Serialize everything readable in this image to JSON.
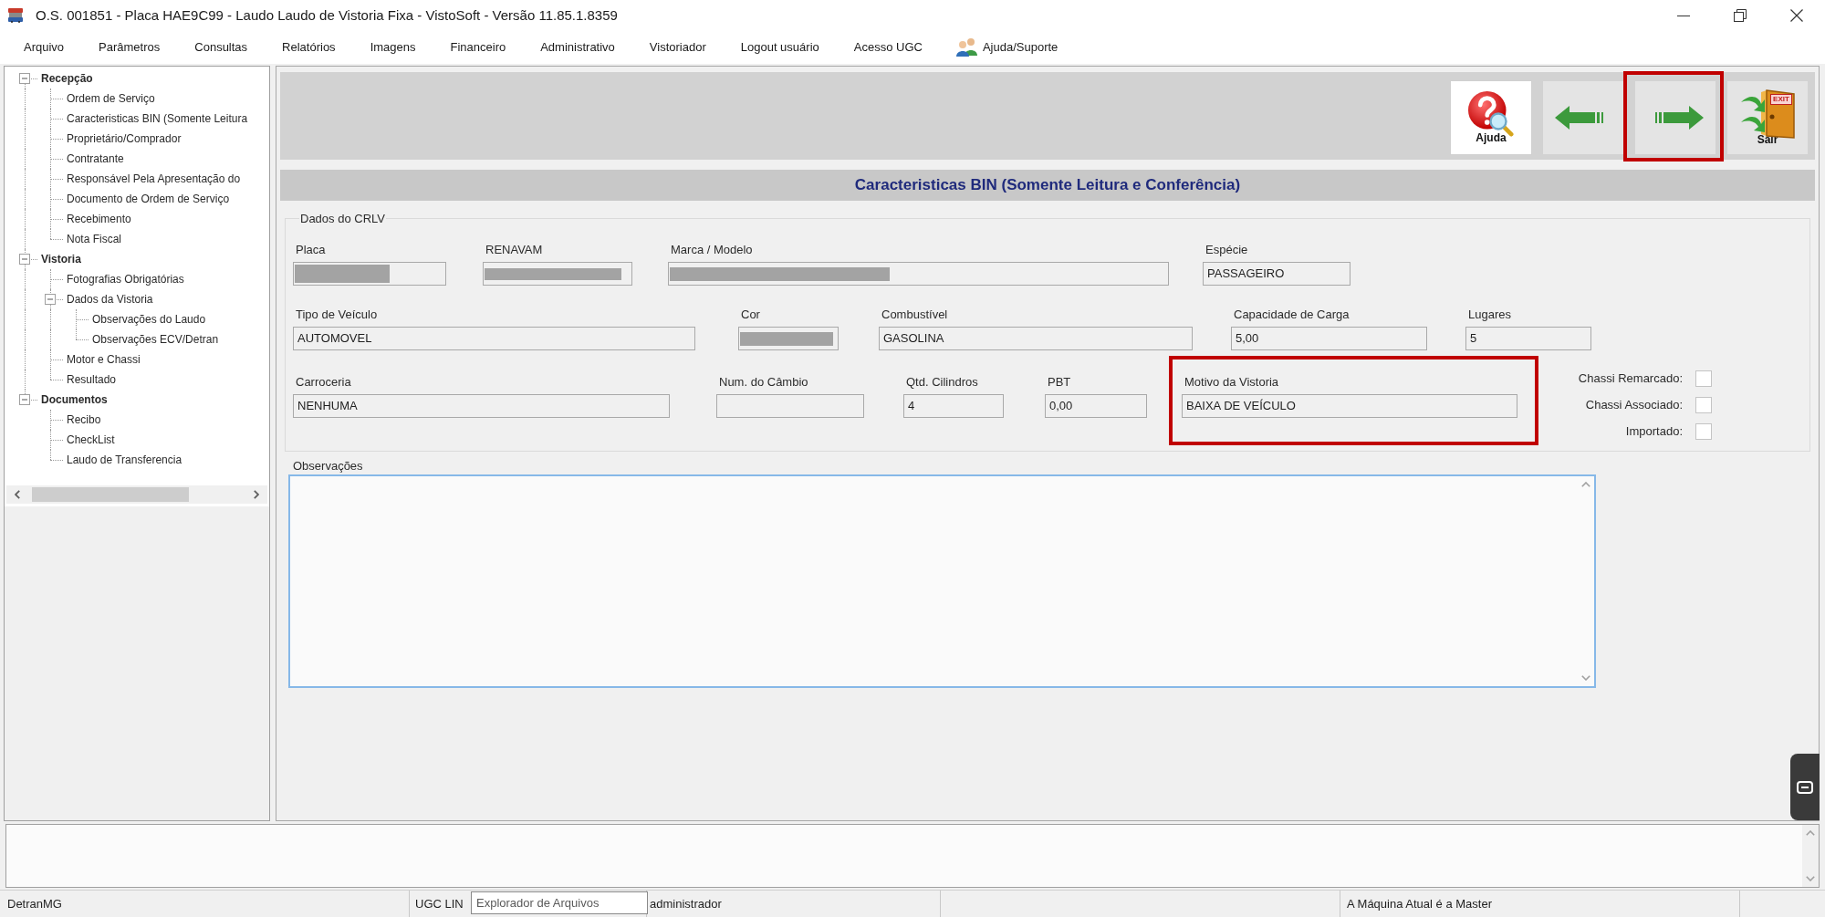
{
  "window": {
    "title": "O.S. 001851 - Placa HAE9C99 - Laudo Laudo de Vistoria Fixa - VistoSoft - Versão 11.85.1.8359"
  },
  "menu": [
    {
      "label": "Arquivo",
      "kind": "text"
    },
    {
      "label": "Parâmetros",
      "kind": "text"
    },
    {
      "label": "Consultas",
      "kind": "text"
    },
    {
      "label": "Relatórios",
      "kind": "text"
    },
    {
      "label": "Imagens",
      "kind": "text"
    },
    {
      "label": "Financeiro",
      "kind": "text"
    },
    {
      "label": "Administrativo",
      "kind": "text"
    },
    {
      "label": "Vistoriador",
      "kind": "text"
    },
    {
      "label": "Logout usuário",
      "kind": "text"
    },
    {
      "label": "Acesso UGC",
      "kind": "text"
    },
    {
      "label": "Ajuda/Suporte",
      "kind": "icon_text"
    }
  ],
  "tree": [
    {
      "label": "Recepção",
      "expanded": true,
      "children": [
        {
          "label": "Ordem de Serviço"
        },
        {
          "label": "Caracteristicas BIN (Somente Leitura"
        },
        {
          "label": "Proprietário/Comprador"
        },
        {
          "label": "Contratante"
        },
        {
          "label": "Responsável Pela Apresentação do"
        },
        {
          "label": "Documento de Ordem de Serviço"
        },
        {
          "label": "Recebimento"
        },
        {
          "label": "Nota Fiscal"
        }
      ]
    },
    {
      "label": "Vistoria",
      "expanded": true,
      "children": [
        {
          "label": "Fotografias Obrigatórias"
        },
        {
          "label": "Dados da Vistoria",
          "expanded": true,
          "children": [
            {
              "label": "Observações do Laudo"
            },
            {
              "label": "Observações ECV/Detran"
            }
          ]
        },
        {
          "label": "Motor e Chassi"
        },
        {
          "label": "Resultado"
        }
      ]
    },
    {
      "label": "Documentos",
      "expanded": true,
      "children": [
        {
          "label": "Recibo"
        },
        {
          "label": "CheckList"
        },
        {
          "label": "Laudo de Transferencia"
        }
      ]
    }
  ],
  "toolbar": [
    {
      "kind": "help",
      "label": "Ajuda",
      "highlighted": false
    },
    {
      "kind": "back",
      "highlighted": false
    },
    {
      "kind": "forward",
      "highlighted": true
    },
    {
      "kind": "exit",
      "label": "Sair",
      "sign": "EXIT",
      "highlighted": false
    }
  ],
  "header": {
    "title": "Caracteristicas BIN (Somente Leitura e Conferência)"
  },
  "form": {
    "group_title": "Dados do CRLV",
    "rows": [
      [
        {
          "label": "Placa",
          "redacted": true,
          "highlighted": false
        },
        {
          "label": "RENAVAM",
          "redacted": true,
          "highlighted": false
        },
        {
          "label": "Marca / Modelo",
          "redacted": true,
          "highlighted": false
        },
        {
          "label": "Espécie",
          "value": "PASSAGEIRO",
          "redacted": false,
          "highlighted": false
        }
      ],
      [
        {
          "label": "Tipo de Veículo",
          "value": "AUTOMOVEL",
          "redacted": false,
          "highlighted": false
        },
        {
          "label": "Cor",
          "redacted": true,
          "highlighted": false
        },
        {
          "label": "Combustível",
          "value": "GASOLINA",
          "redacted": false,
          "highlighted": false
        },
        {
          "label": "Capacidade de Carga",
          "value": "5,00",
          "redacted": false,
          "highlighted": false
        },
        {
          "label": "Lugares",
          "value": "5",
          "redacted": false,
          "highlighted": false
        }
      ],
      [
        {
          "label": "Carroceria",
          "value": "NENHUMA",
          "redacted": false,
          "highlighted": false
        },
        {
          "label": "Num. do Câmbio",
          "redacted": false,
          "highlighted": false
        },
        {
          "label": "Qtd. Cilindros",
          "value": "4",
          "redacted": false,
          "highlighted": false
        },
        {
          "label": "PBT",
          "value": "0,00",
          "redacted": false,
          "highlighted": false
        },
        {
          "label": "Motivo da Vistoria",
          "value": "BAIXA DE VEÍCULO",
          "redacted": false,
          "highlighted": true
        }
      ]
    ],
    "flags": [
      {
        "label": "Chassi Remarcado:",
        "checked": false
      },
      {
        "label": "Chassi Associado:",
        "checked": false
      },
      {
        "label": "Importado:",
        "checked": false
      }
    ],
    "observations": {
      "label": "Observações"
    }
  },
  "status_bar": {
    "panels": [
      {
        "text": "DetranMG"
      },
      {
        "text": "UGC LIN"
      },
      {
        "text": "administrador"
      },
      {
        "text": "A Máquina Atual é a Master"
      }
    ]
  },
  "tooltip": {
    "text": "Explorador de Arquivos"
  }
}
